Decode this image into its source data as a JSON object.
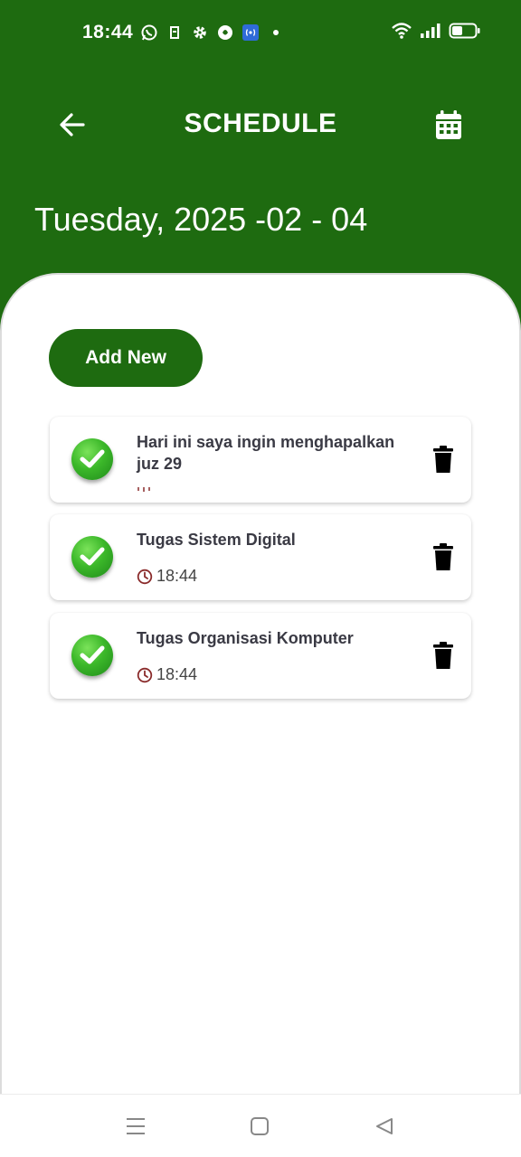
{
  "status_bar": {
    "time": "18:44",
    "left_icons": [
      "whatsapp-icon",
      "notification-icon",
      "gear-icon",
      "app-icon",
      "hotspot-icon",
      "dot-icon"
    ],
    "right_icons": [
      "wifi-icon",
      "signal-icon",
      "battery-icon"
    ]
  },
  "appbar": {
    "title": "SCHEDULE",
    "back_icon": "arrow-left-icon",
    "calendar_icon": "calendar-icon"
  },
  "selected_date": "Tuesday, 2025 -02 - 04",
  "add_button_label": "Add New",
  "tasks": [
    {
      "title": "Hari ini saya ingin menghapalkan juz 29",
      "time": ""
    },
    {
      "title": "Tugas Sistem Digital",
      "time": "18:44"
    },
    {
      "title": "Tugas Organisasi Komputer",
      "time": "18:44"
    }
  ],
  "colors": {
    "primary": "#1e6b10",
    "check": "#3cb82a",
    "clock": "#8a2b2b"
  },
  "nav_icons": [
    "menu-icon",
    "home-icon",
    "back-icon"
  ]
}
